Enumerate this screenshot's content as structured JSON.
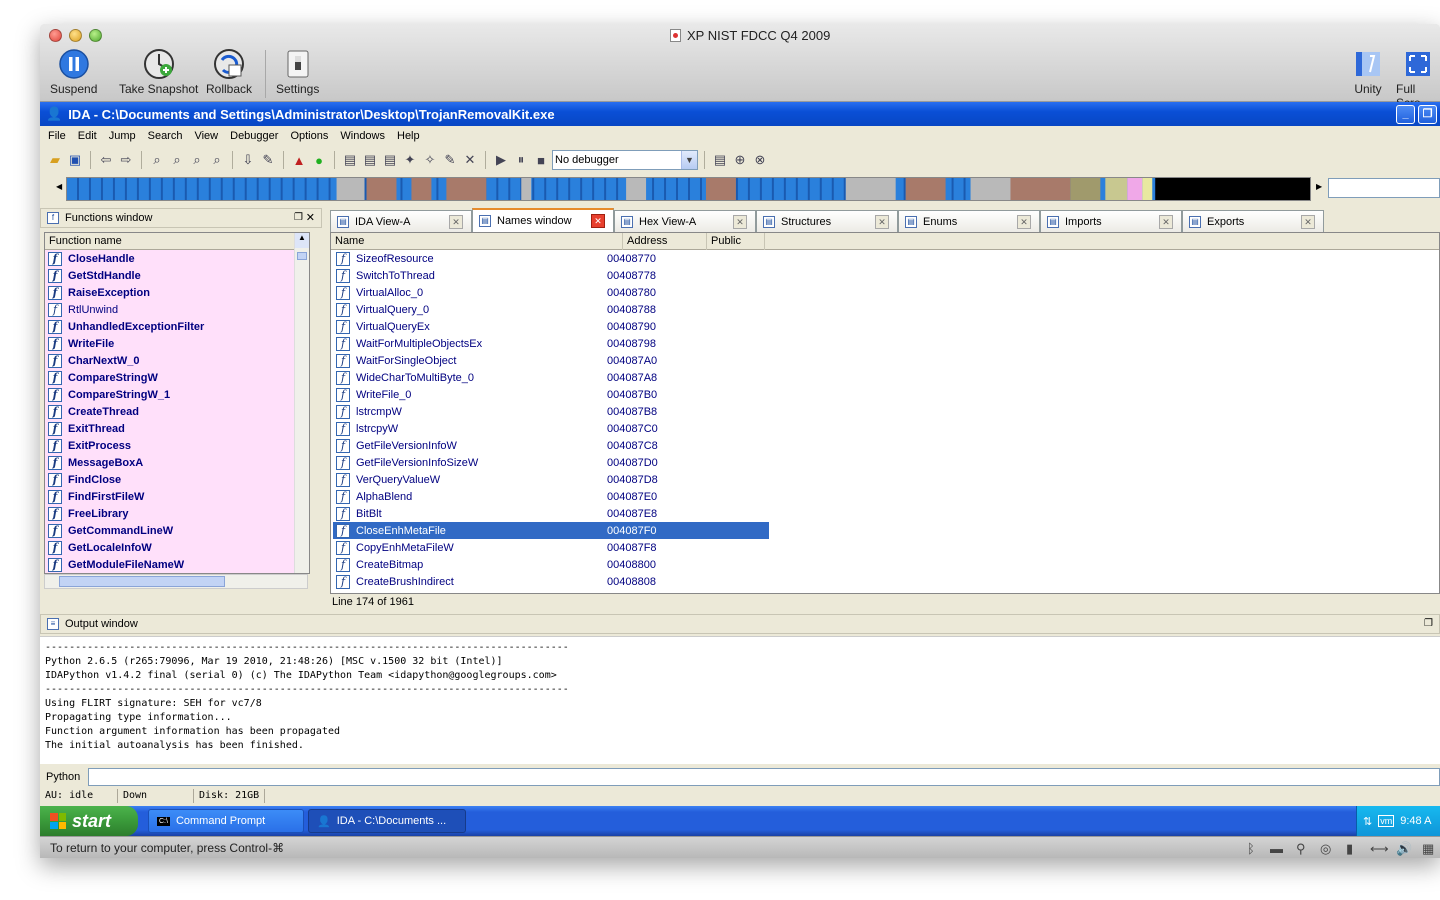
{
  "vm": {
    "title": "XP NIST FDCC Q4 2009",
    "tools": {
      "suspend": "Suspend",
      "snapshot": "Take Snapshot",
      "rollback": "Rollback",
      "settings": "Settings",
      "unity": "Unity",
      "fullscreen": "Full Scre"
    },
    "bottom_hint": "To return to your computer, press Control-⌘"
  },
  "ida": {
    "title": "IDA - C:\\Documents and Settings\\Administrator\\Desktop\\TrojanRemovalKit.exe",
    "menu": [
      "File",
      "Edit",
      "Jump",
      "Search",
      "View",
      "Debugger",
      "Options",
      "Windows",
      "Help"
    ],
    "debugger_select": "No debugger",
    "functions": {
      "title": "Functions window",
      "column": "Function name",
      "items": [
        {
          "name": "CloseHandle",
          "bold": true
        },
        {
          "name": "GetStdHandle",
          "bold": true
        },
        {
          "name": "RaiseException",
          "bold": true
        },
        {
          "name": "RtlUnwind",
          "bold": false
        },
        {
          "name": "UnhandledExceptionFilter",
          "bold": true
        },
        {
          "name": "WriteFile",
          "bold": true
        },
        {
          "name": "CharNextW_0",
          "bold": true
        },
        {
          "name": "CompareStringW",
          "bold": true
        },
        {
          "name": "CompareStringW_1",
          "bold": true
        },
        {
          "name": "CreateThread",
          "bold": true
        },
        {
          "name": "ExitThread",
          "bold": true
        },
        {
          "name": "ExitProcess",
          "bold": true
        },
        {
          "name": "MessageBoxA",
          "bold": true
        },
        {
          "name": "FindClose",
          "bold": true
        },
        {
          "name": "FindFirstFileW",
          "bold": true
        },
        {
          "name": "FreeLibrary",
          "bold": true
        },
        {
          "name": "GetCommandLineW",
          "bold": true
        },
        {
          "name": "GetLocaleInfoW",
          "bold": true
        },
        {
          "name": "GetModuleFileNameW",
          "bold": true
        }
      ]
    },
    "tabs": [
      {
        "label": "IDA View-A",
        "active": false,
        "icon": "ida-view-icon"
      },
      {
        "label": "Names window",
        "active": true,
        "icon": "names-icon"
      },
      {
        "label": "Hex View-A",
        "active": false,
        "icon": "hex-view-icon"
      },
      {
        "label": "Structures",
        "active": false,
        "icon": "structures-icon"
      },
      {
        "label": "Enums",
        "active": false,
        "icon": "enums-icon"
      },
      {
        "label": "Imports",
        "active": false,
        "icon": "imports-icon"
      },
      {
        "label": "Exports",
        "active": false,
        "icon": "exports-icon"
      }
    ],
    "names": {
      "columns": {
        "name": "Name",
        "address": "Address",
        "public": "Public"
      },
      "rows": [
        {
          "name": "SizeofResource",
          "address": "00408770"
        },
        {
          "name": "SwitchToThread",
          "address": "00408778"
        },
        {
          "name": "VirtualAlloc_0",
          "address": "00408780"
        },
        {
          "name": "VirtualQuery_0",
          "address": "00408788"
        },
        {
          "name": "VirtualQueryEx",
          "address": "00408790"
        },
        {
          "name": "WaitForMultipleObjectsEx",
          "address": "00408798"
        },
        {
          "name": "WaitForSingleObject",
          "address": "004087A0"
        },
        {
          "name": "WideCharToMultiByte_0",
          "address": "004087A8"
        },
        {
          "name": "WriteFile_0",
          "address": "004087B0"
        },
        {
          "name": "lstrcmpW",
          "address": "004087B8"
        },
        {
          "name": "lstrcpyW",
          "address": "004087C0"
        },
        {
          "name": "GetFileVersionInfoW",
          "address": "004087C8"
        },
        {
          "name": "GetFileVersionInfoSizeW",
          "address": "004087D0"
        },
        {
          "name": "VerQueryValueW",
          "address": "004087D8"
        },
        {
          "name": "AlphaBlend",
          "address": "004087E0"
        },
        {
          "name": "BitBlt",
          "address": "004087E8"
        },
        {
          "name": "CloseEnhMetaFile",
          "address": "004087F0",
          "selected": true
        },
        {
          "name": "CopyEnhMetaFileW",
          "address": "004087F8"
        },
        {
          "name": "CreateBitmap",
          "address": "00408800"
        },
        {
          "name": "CreateBrushIndirect",
          "address": "00408808"
        }
      ],
      "line_status": "Line 174 of 1961"
    },
    "output": {
      "title": "Output window",
      "lines": [
        "---------------------------------------------------------------------------------------",
        "Python 2.6.5 (r265:79096, Mar 19 2010, 21:48:26) [MSC v.1500 32 bit (Intel)]",
        "IDAPython v1.4.2 final (serial 0) (c) The IDAPython Team <idapython@googlegroups.com>",
        "---------------------------------------------------------------------------------------",
        "Using FLIRT signature: SEH for vc7/8",
        "Propagating type information...",
        "Function argument information has been propagated",
        "The initial autoanalysis has been finished."
      ]
    },
    "python_label": "Python",
    "status": {
      "au": "AU:  idle",
      "dir": "Down",
      "disk": "Disk: 21GB"
    }
  },
  "taskbar": {
    "start": "start",
    "items": [
      {
        "label": "Command Prompt"
      },
      {
        "label": "IDA - C:\\Documents ..."
      }
    ],
    "clock": "9:48 A"
  }
}
